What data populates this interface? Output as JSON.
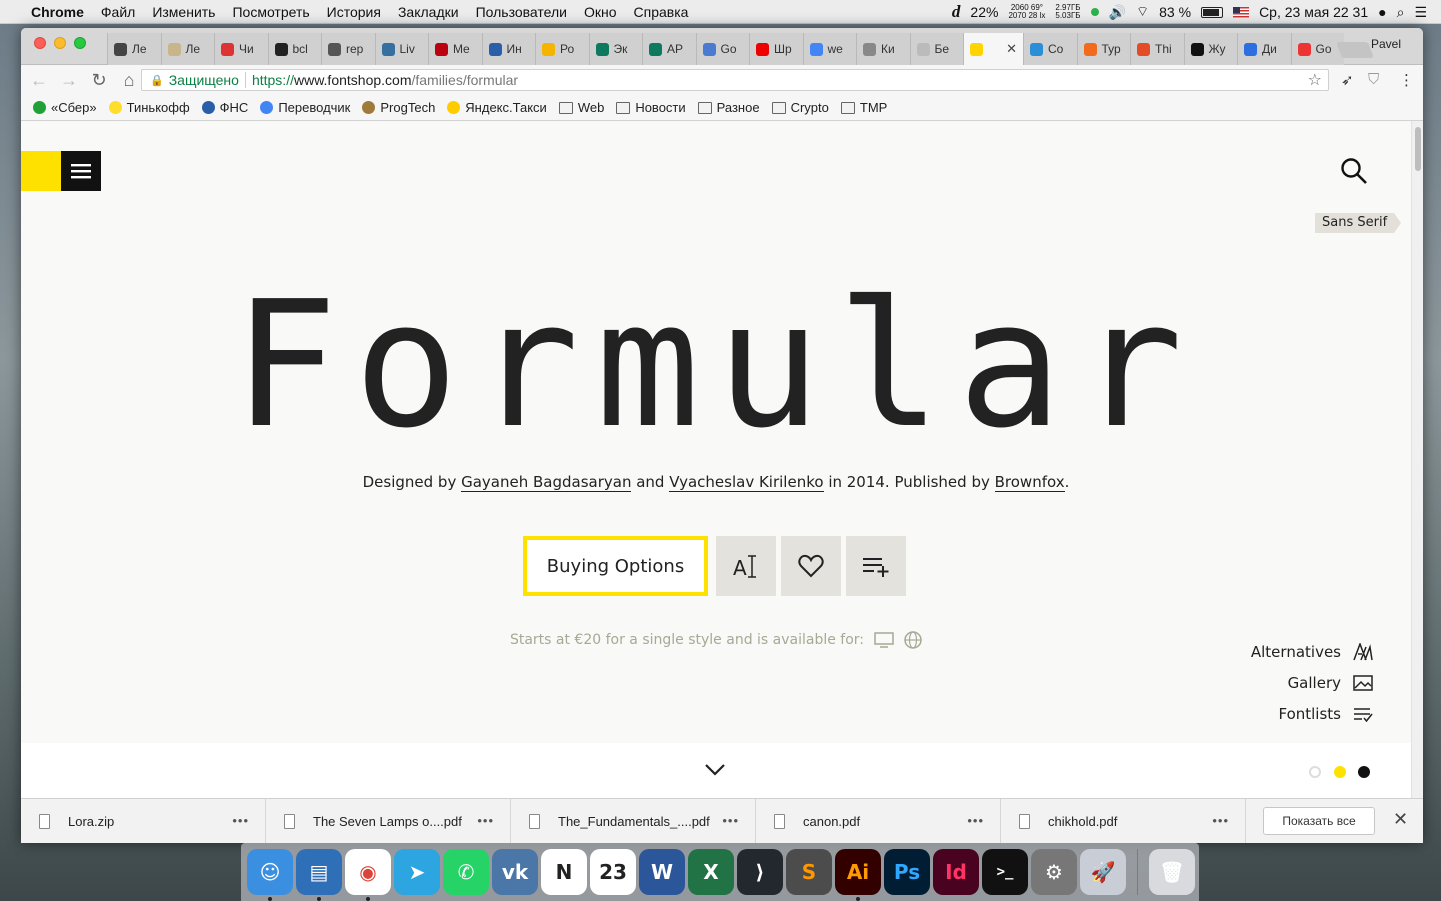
{
  "menubar": {
    "app": "Chrome",
    "items": [
      "Файл",
      "Изменить",
      "Посмотреть",
      "История",
      "Закладки",
      "Пользователи",
      "Окно",
      "Справка"
    ],
    "status": {
      "cpu": "22%",
      "sensor_top": "2060  69°",
      "sensor_bottom": "2070  28 lx",
      "mem_top": "2.97ГБ",
      "mem_bottom": "5.03ГБ",
      "battery": "83 %",
      "datetime": "Ср, 23 мая  22 31"
    }
  },
  "tabs": [
    {
      "label": "Ле",
      "color": "#444"
    },
    {
      "label": "Ле",
      "color": "#c8b68a"
    },
    {
      "label": "Чи",
      "color": "#d33"
    },
    {
      "label": "bcl",
      "color": "#222"
    },
    {
      "label": "rep",
      "color": "#555"
    },
    {
      "label": "Liv",
      "color": "#3670a0"
    },
    {
      "label": "Me",
      "color": "#b01"
    },
    {
      "label": "Ин",
      "color": "#2a5ea8"
    },
    {
      "label": "Ро",
      "color": "#f4b400"
    },
    {
      "label": "Эк",
      "color": "#0d7a5f"
    },
    {
      "label": "AP",
      "color": "#0d7a5f"
    },
    {
      "label": "Go",
      "color": "#4a7bd0"
    },
    {
      "label": "Шр",
      "color": "#e00"
    },
    {
      "label": "we",
      "color": "#4285f4"
    },
    {
      "label": "Ки",
      "color": "#888"
    },
    {
      "label": "Бе",
      "color": "#bbb"
    },
    {
      "label": "",
      "color": "#ffd400",
      "active": true
    },
    {
      "label": "Co",
      "color": "#2a8fd6"
    },
    {
      "label": "Тур",
      "color": "#f26b1d"
    },
    {
      "label": "Thi",
      "color": "#e34c26"
    },
    {
      "label": "Жу",
      "color": "#111"
    },
    {
      "label": "Ди",
      "color": "#2d6ee0"
    },
    {
      "label": "Go",
      "color": "#e33"
    }
  ],
  "profile": "Pavel",
  "omnibox": {
    "secure_label": "Защищено",
    "scheme": "https://",
    "host": "www.fontshop.com",
    "path": "/families/formular"
  },
  "bookmarks": [
    {
      "label": "«Сбер»",
      "color": "#21a038"
    },
    {
      "label": "Тинькофф",
      "color": "#ffdd2d"
    },
    {
      "label": "ФНС",
      "color": "#2a5ea8"
    },
    {
      "label": "Переводчик",
      "color": "#4285f4"
    },
    {
      "label": "ProgTech",
      "color": "#a07a3a"
    },
    {
      "label": "Яндекс.Такси",
      "color": "#ffcc00"
    },
    {
      "label": "Web",
      "folder": true
    },
    {
      "label": "Новости",
      "folder": true
    },
    {
      "label": "Разное",
      "folder": true
    },
    {
      "label": "Crypto",
      "folder": true
    },
    {
      "label": "TMP",
      "folder": true
    }
  ],
  "page": {
    "category_tag": "Sans Serif",
    "font_name": "Formular",
    "credits": {
      "prefix": "Designed by ",
      "designer1": "Gayaneh Bagdasaryan",
      "and": " and ",
      "designer2": "Vyacheslav Kirilenko",
      "middle": " in 2014. Published by ",
      "publisher": "Brownfox",
      "suffix": "."
    },
    "buy_label": "Buying Options",
    "starts_text": "Starts at €20 for a single style and is available for:",
    "side_links": [
      "Alternatives",
      "Gallery",
      "Fontlists"
    ],
    "accent": "#ffe100"
  },
  "downloads": [
    {
      "name": "Lora.zip"
    },
    {
      "name": "The Seven Lamps o....pdf"
    },
    {
      "name": "The_Fundamentals_....pdf"
    },
    {
      "name": "canon.pdf"
    },
    {
      "name": "chikhold.pdf"
    }
  ],
  "show_all": "Показать все",
  "dock": [
    {
      "name": "finder",
      "bg": "#3b8fe0",
      "label": "☺",
      "run": true
    },
    {
      "name": "preview",
      "bg": "#2f6fb8",
      "label": "▤",
      "run": true
    },
    {
      "name": "chrome",
      "bg": "#ffffff",
      "label": "◉",
      "run": true
    },
    {
      "name": "telegram",
      "bg": "#2ca5e0",
      "label": "➤",
      "run": false
    },
    {
      "name": "whatsapp",
      "bg": "#25d366",
      "label": "✆",
      "run": false
    },
    {
      "name": "vk",
      "bg": "#4a76a8",
      "label": "vk",
      "run": false
    },
    {
      "name": "notion",
      "bg": "#ffffff",
      "label": "N",
      "run": false
    },
    {
      "name": "calendar",
      "bg": "#ffffff",
      "label": "23",
      "run": false
    },
    {
      "name": "word",
      "bg": "#2b579a",
      "label": "W",
      "run": false
    },
    {
      "name": "excel",
      "bg": "#217346",
      "label": "X",
      "run": false
    },
    {
      "name": "vscode",
      "bg": "#23272e",
      "label": "⟩",
      "run": false
    },
    {
      "name": "sublime",
      "bg": "#4c4c4c",
      "label": "S",
      "run": false
    },
    {
      "name": "illustrator",
      "bg": "#300",
      "label": "Ai",
      "run": true
    },
    {
      "name": "photoshop",
      "bg": "#001d34",
      "label": "Ps",
      "run": false
    },
    {
      "name": "indesign",
      "bg": "#49021f",
      "label": "Id",
      "run": false
    },
    {
      "name": "terminal",
      "bg": "#111",
      "label": ">_",
      "run": false
    },
    {
      "name": "preferences",
      "bg": "#777",
      "label": "⚙",
      "run": false
    },
    {
      "name": "launchpad",
      "bg": "#c9ced6",
      "label": "🚀",
      "run": false
    },
    {
      "name": "trash",
      "bg": "#d8dade",
      "label": "🗑",
      "run": false
    }
  ]
}
